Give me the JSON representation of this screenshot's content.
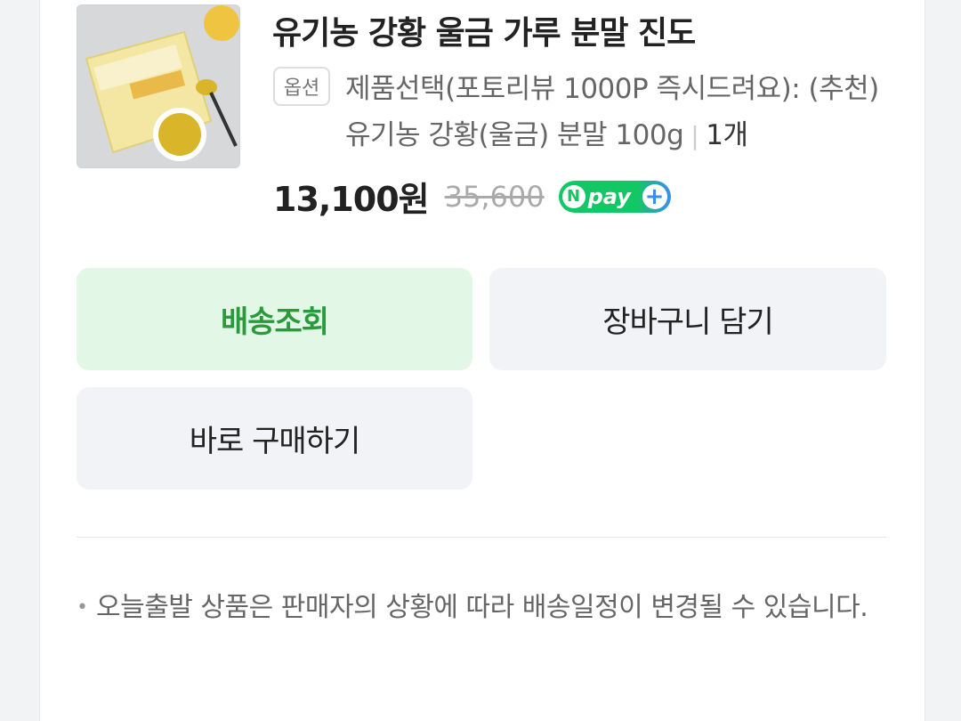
{
  "product": {
    "title": "유기농 강황 울금 가루 분말 진도",
    "option_badge": "옵션",
    "option_text": "제품선택(포토리뷰 1000P 즉시드려요): (추천)유기농 강황(울금) 분말 100g",
    "quantity": "1개",
    "price": "13,100원",
    "original_price": "35,600",
    "npay_label": "pay",
    "npay_icon_letter": "N"
  },
  "actions": {
    "shipping_label": "배송조회",
    "cart_label": "장바구니 담기",
    "buy_label": "바로 구매하기"
  },
  "notice": {
    "text": "오늘출발 상품은 판매자의 상황에 따라 배송일정이 변경될 수 있습니다."
  },
  "colors": {
    "accent_green": "#2a9a3d",
    "shipping_button_bg": "#e3f7e6",
    "npay_green": "#13c764",
    "npay_blue": "#3a8ef0"
  }
}
